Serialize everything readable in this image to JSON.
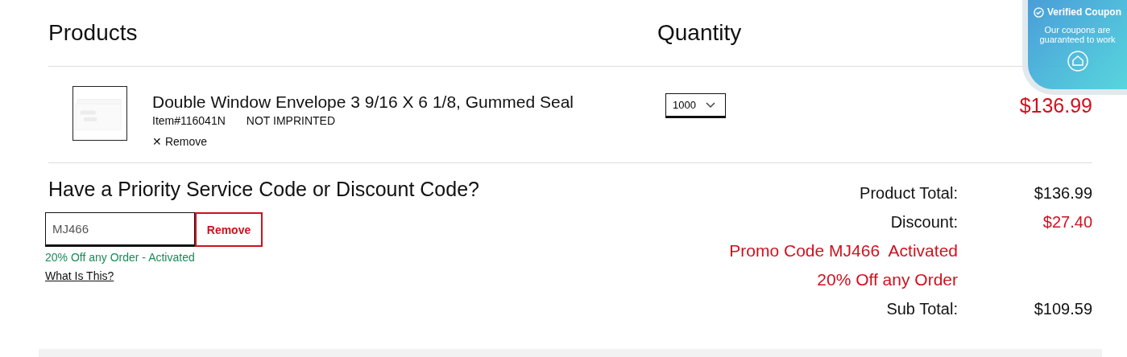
{
  "columns": [
    "Products",
    "Quantity"
  ],
  "item": {
    "name": "Double Window Envelope 3 9/16 X 6 1/8, Gummed Seal",
    "sku": "Item#116041N",
    "imprint": "NOT IMPRINTED",
    "remove": "Remove",
    "remove_icon": "✕",
    "quantity": "1000",
    "price": "$136.99"
  },
  "coupon": {
    "title": "Have a Priority Service Code or Discount Code?",
    "value": "MJ466",
    "remove": "Remove",
    "status": "20% Off any Order - Activated",
    "help": "What Is This?"
  },
  "totals": [
    {
      "label": "Product Total:",
      "value": "$136.99",
      "kind": "plain"
    },
    {
      "label": "Discount:",
      "value": "$27.40",
      "kind": "discount"
    },
    {
      "label": "Promo Code MJ466  Activated",
      "kind": "note"
    },
    {
      "label": "20% Off any Order",
      "kind": "note"
    },
    {
      "label": "Sub Total:",
      "value": "$109.59",
      "kind": "plain"
    }
  ],
  "badge": {
    "title": "Verified Coupon",
    "text": "Our coupons are guaranteed to work"
  }
}
